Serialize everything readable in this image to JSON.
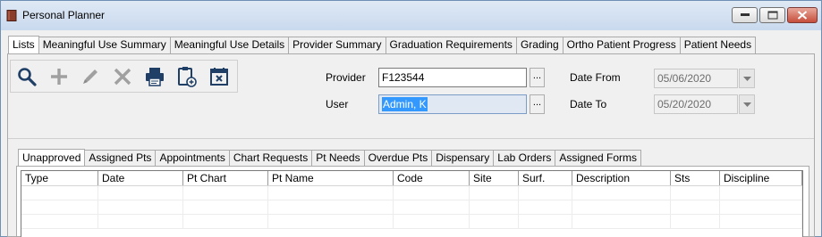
{
  "window": {
    "title": "Personal Planner"
  },
  "main_tabs": [
    {
      "label": "Lists",
      "active": true
    },
    {
      "label": "Meaningful Use Summary"
    },
    {
      "label": "Meaningful Use Details"
    },
    {
      "label": "Provider Summary"
    },
    {
      "label": "Graduation Requirements"
    },
    {
      "label": "Grading"
    },
    {
      "label": "Ortho Patient Progress"
    },
    {
      "label": "Patient Needs"
    }
  ],
  "toolbar": {
    "icons": [
      "search-icon",
      "add-icon",
      "edit-icon",
      "delete-icon",
      "print-icon",
      "clipboard-add-icon",
      "calendar-remove-icon"
    ]
  },
  "filters": {
    "provider_label": "Provider",
    "provider_value": "F123544",
    "user_label": "User",
    "user_value": "Admin, K",
    "dots": "...",
    "date_from_label": "Date From",
    "date_from_value": "05/06/2020",
    "date_to_label": "Date To",
    "date_to_value": "05/20/2020"
  },
  "sub_tabs": [
    {
      "label": "Unapproved",
      "active": true
    },
    {
      "label": "Assigned Pts"
    },
    {
      "label": "Appointments"
    },
    {
      "label": "Chart Requests"
    },
    {
      "label": "Pt Needs"
    },
    {
      "label": "Overdue Pts"
    },
    {
      "label": "Dispensary"
    },
    {
      "label": "Lab Orders"
    },
    {
      "label": "Assigned Forms"
    }
  ],
  "grid": {
    "columns": [
      "Type",
      "Date",
      "Pt Chart",
      "Pt Name",
      "Code",
      "Site",
      "Surf.",
      "Description",
      "Sts",
      "Discipline"
    ]
  },
  "colors": {
    "title_gradient_top": "#dfe9f5",
    "close_button": "#c64d3b",
    "selection": "#3399ff"
  }
}
